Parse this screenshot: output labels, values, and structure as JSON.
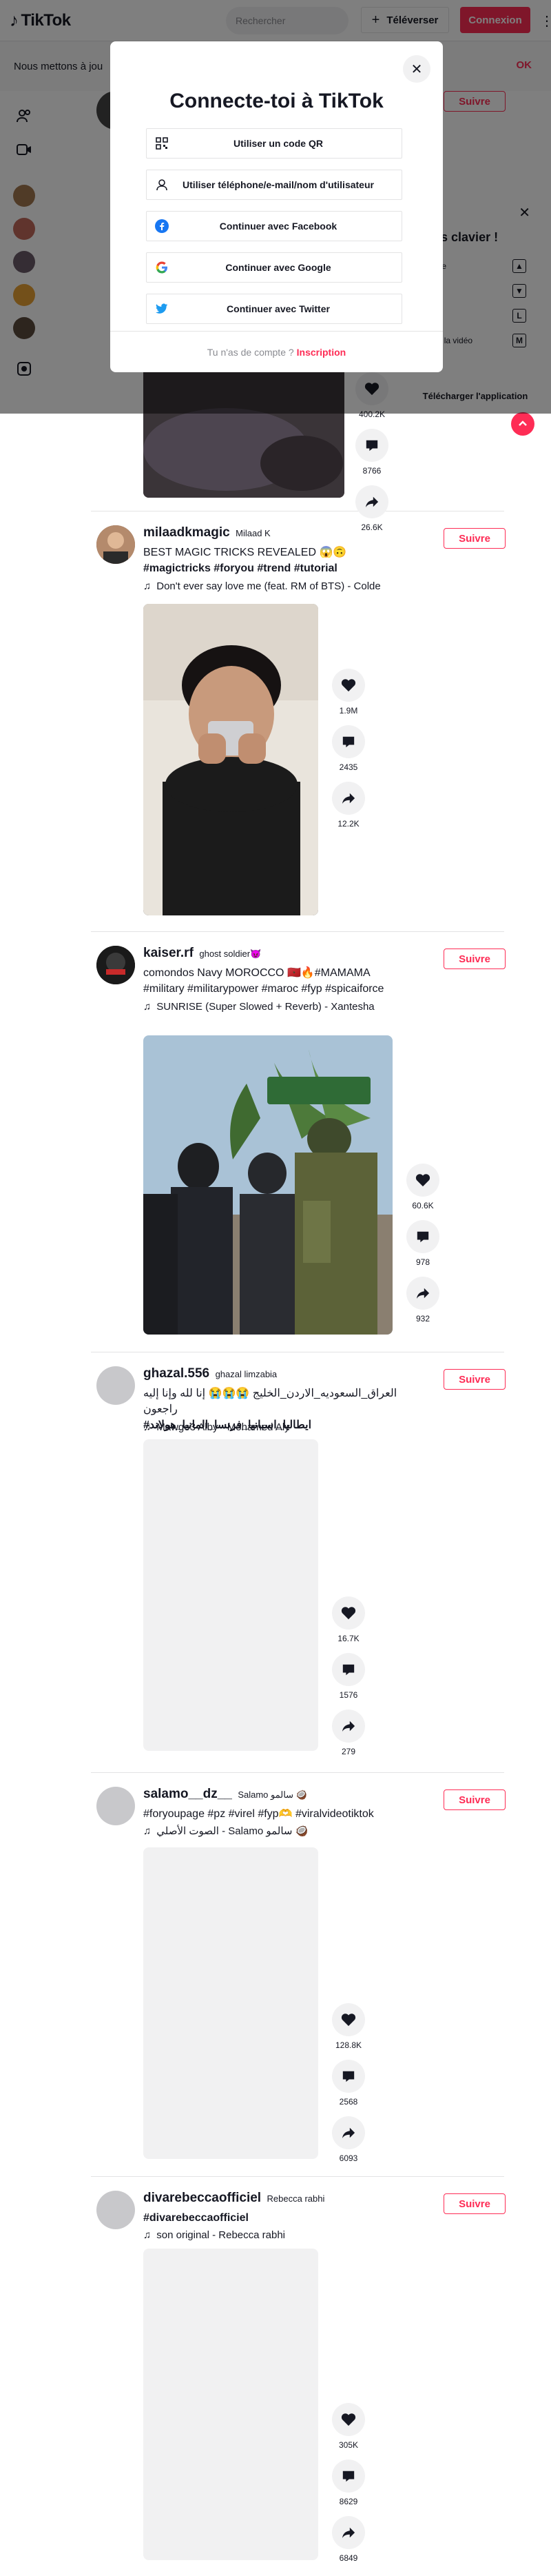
{
  "header": {
    "logo_text": "TikTok",
    "search_placeholder": "Rechercher",
    "upload_label": "Téléverser",
    "login_label": "Connexion"
  },
  "cookie": {
    "text": "Nous mettons à jou",
    "ok_label": "OK"
  },
  "modal": {
    "title": "Connecte-toi à TikTok",
    "options": [
      {
        "label": "Utiliser un code QR",
        "icon": "qr-code-icon"
      },
      {
        "label": "Utiliser téléphone/e-mail/nom d'utilisateur",
        "icon": "user-icon"
      },
      {
        "label": "Continuer avec Facebook",
        "icon": "facebook-icon"
      },
      {
        "label": "Continuer avec Google",
        "icon": "google-icon"
      },
      {
        "label": "Continuer avec Twitter",
        "icon": "twitter-icon"
      }
    ],
    "footer_text": "Tu n'as de compte ?",
    "signup_label": "Inscription"
  },
  "shortcuts": {
    "title": "rcis clavier !",
    "rows": [
      {
        "label": "dente",
        "key": "▲"
      },
      {
        "label": "r",
        "key": "▼"
      },
      {
        "label": "",
        "key": "L"
      },
      {
        "label": "n de la vidéo",
        "key": "M"
      }
    ],
    "download_label": "Télécharger l'application"
  },
  "first_post": {
    "counts": [
      "400.2K",
      "8766",
      "26.6K"
    ]
  },
  "posts": [
    {
      "username": "milaadkmagic",
      "nickname": "Milaad K",
      "caption": "BEST MAGIC TRICKS REVEALED 😱🙃",
      "hashtags": "#magictricks #foryou #trend #tutorial",
      "music": "Don't ever say love me (feat. RM of BTS) - Colde",
      "follow_label": "Suivre",
      "likes": "1.9M",
      "comments": "2435",
      "shares": "12.2K"
    },
    {
      "username": "kaiser.rf",
      "nickname": "ghost soldier😈",
      "caption": "comondos Navy MOROCCO 🇲🇦🔥#MAMAMA #military #militarypower #maroc #fyp #spicaiforce",
      "hashtags": "",
      "music": "SUNRISE (Super Slowed + Reverb) - Xantesha",
      "follow_label": "Suivre",
      "likes": "60.6K",
      "comments": "978",
      "shares": "932"
    },
    {
      "username": "ghazal.556",
      "nickname": "ghazal limzabia",
      "caption": "العراق_السعوديه_الاردن_الخليج 😭😭😭 إنا لله وإنا إليه راجعون",
      "hashtags": "ايطاليا_اسبانيا_فرنسا_المانيا_هولاند#",
      "music": "Mawgo3 Alby - Mohamed Aly",
      "follow_label": "Suivre",
      "likes": "16.7K",
      "comments": "1576",
      "shares": "279"
    },
    {
      "username": "salamo__dz__",
      "nickname": "Salamo سالمو 🥥",
      "caption": "#foryoupage #pz #virel #fyp🫶 #viralvideotiktok",
      "hashtags": "",
      "music": "الصوت الأصلي - Salamo سالمو 🥥",
      "follow_label": "Suivre",
      "likes": "128.8K",
      "comments": "2568",
      "shares": "6093"
    },
    {
      "username": "divarebeccaofficiel",
      "nickname": "Rebecca rabhi",
      "caption": "#divarebeccaofficiel",
      "hashtags": "",
      "music": "son original - Rebecca rabhi",
      "follow_label": "Suivre",
      "likes": "305K",
      "comments": "8629",
      "shares": "6849"
    }
  ],
  "colors": {
    "brand": "#fe2c55",
    "text": "#161823",
    "muted": "#8a8b91",
    "surface": "#f1f1f2"
  }
}
